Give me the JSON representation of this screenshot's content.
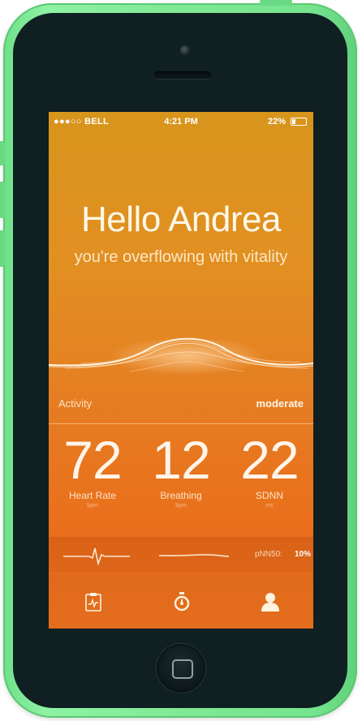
{
  "status_bar": {
    "carrier": "●●●○○ BELL",
    "time": "4:21 PM",
    "battery_text": "22%",
    "battery_level": 0.22
  },
  "greeting": "Hello Andrea",
  "subtitle": "you're overflowing with vitality",
  "activity": {
    "label": "Activity",
    "value": "moderate"
  },
  "metrics": [
    {
      "value": "72",
      "label": "Heart Rate",
      "unit": "bpm"
    },
    {
      "value": "12",
      "label": "Breathing",
      "unit": "bpm"
    },
    {
      "value": "22",
      "label": "SDNN",
      "unit": "ms"
    }
  ],
  "pnn50": {
    "label": "pNN50:",
    "value": "10%"
  },
  "tabs": [
    {
      "icon": "clipboard-chart-icon"
    },
    {
      "icon": "stopwatch-icon"
    },
    {
      "icon": "user-icon"
    }
  ],
  "colors": {
    "phone_shell": "#7fe995",
    "bezel": "#0f1f22",
    "screen_top": "#d7951c",
    "screen_bottom": "#e8661a"
  }
}
